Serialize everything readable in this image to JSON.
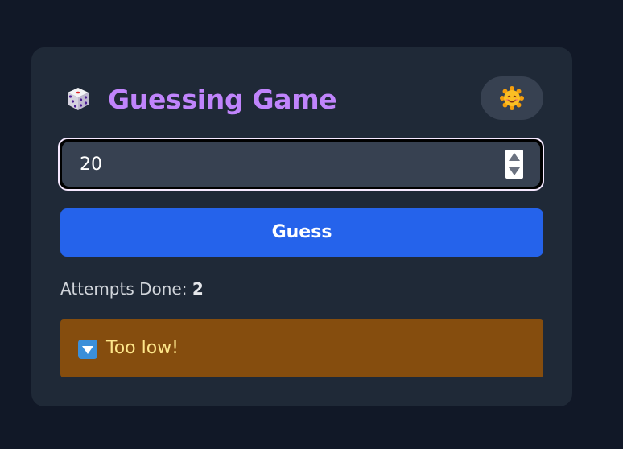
{
  "header": {
    "icon": "dice-icon",
    "title": "Guessing Game",
    "theme_toggle_icon": "smiling-sun-icon"
  },
  "guess_input": {
    "value": "20"
  },
  "guess_button": {
    "label": "Guess"
  },
  "attempts": {
    "label": "Attempts Done:",
    "count": "2"
  },
  "feedback": {
    "icon": "down-arrow-icon",
    "message": "Too low!",
    "colors": {
      "background": "#854d0e",
      "text": "#fde68a"
    }
  },
  "colors": {
    "page_background": "#111827",
    "card_background": "#1f2937",
    "title": "#c084fc",
    "button": "#2563eb"
  }
}
